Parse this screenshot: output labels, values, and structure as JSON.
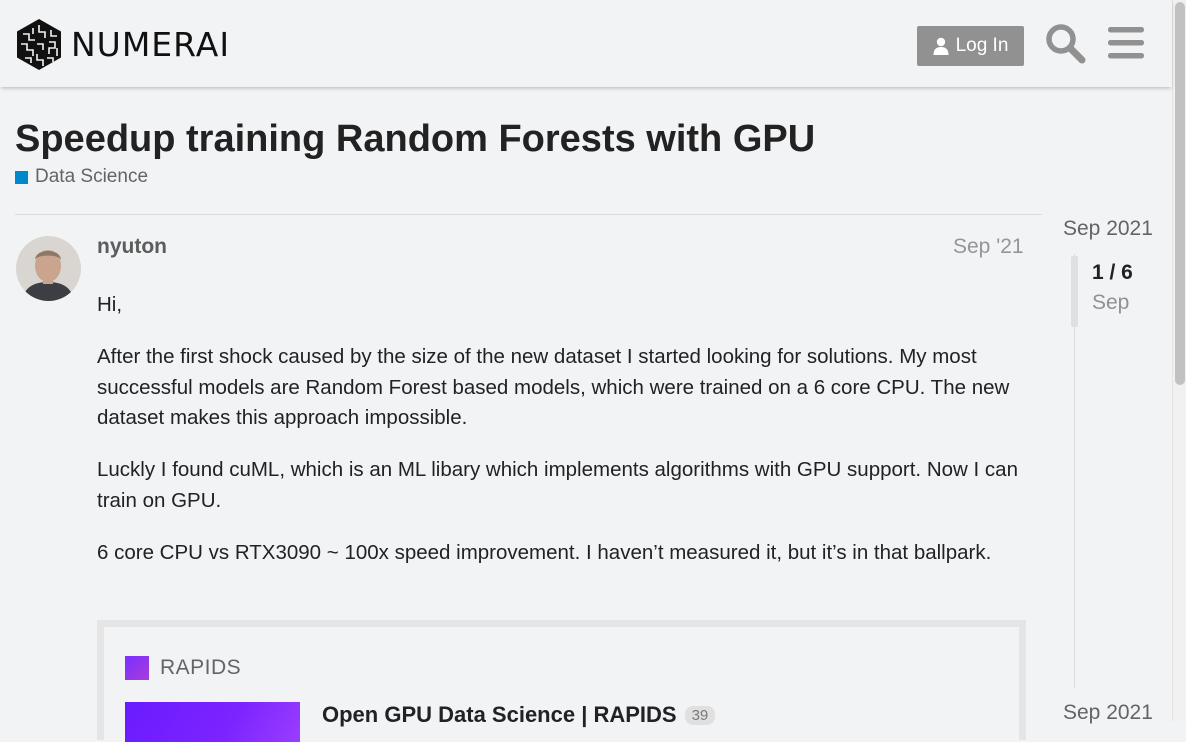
{
  "header": {
    "brand": "NUMERAI",
    "login_label": "Log In"
  },
  "topic": {
    "title": "Speedup training Random Forests with GPU",
    "category": "Data Science",
    "category_color": "#0088cc"
  },
  "post": {
    "username": "nyuton",
    "date": "Sep '21",
    "paragraphs": [
      "Hi,",
      "After the first shock caused by the size of the new dataset I started looking for solutions. My most successful models are Random Forest based models, which were trained on a 6 core CPU. The new dataset makes this approach impossible.",
      "Luckly I found cuML, which is an ML libary which implements algorithms with GPU support. Now I can train on GPU.",
      "6 core CPU vs RTX3090 ~ 100x speed improvement. I haven’t measured it, but it’s in that ballpark."
    ],
    "onebox": {
      "source": "RAPIDS",
      "title": "Open GPU Data Science | RAPIDS",
      "clicks": "39"
    }
  },
  "timeline": {
    "start_date": "Sep 2021",
    "progress": "1 / 6",
    "current_label": "Sep",
    "end_date": "Sep 2021"
  },
  "icons": {
    "search": "search-icon",
    "menu": "hamburger-menu-icon",
    "user": "user-icon"
  }
}
